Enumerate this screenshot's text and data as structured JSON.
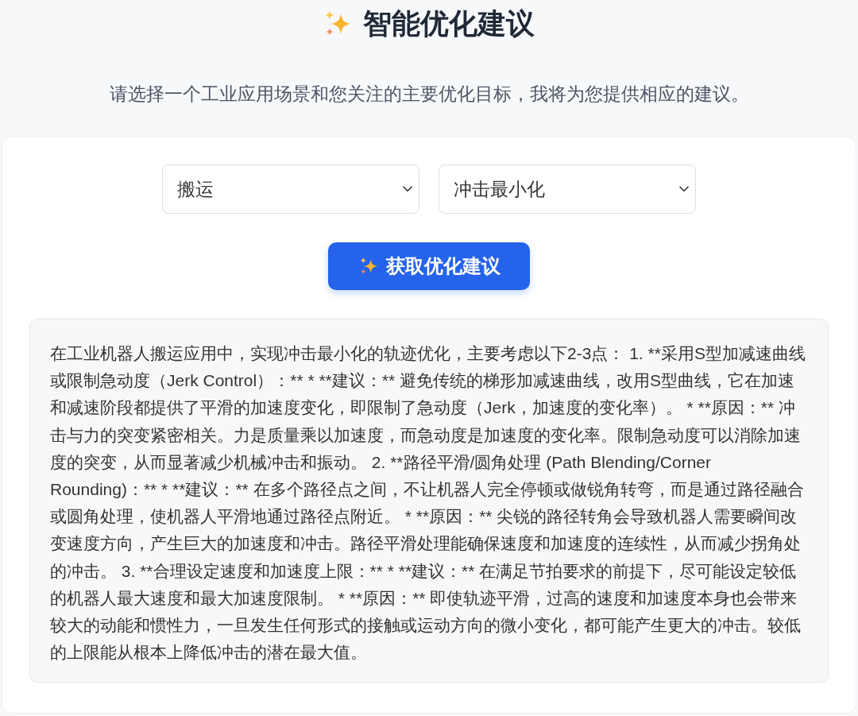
{
  "header": {
    "title": "智能优化建议",
    "subtitle": "请选择一个工业应用场景和您关注的主要优化目标，我将为您提供相应的建议。"
  },
  "form": {
    "selects": [
      {
        "value": "搬运"
      },
      {
        "value": "冲击最小化"
      }
    ],
    "button": {
      "label": "获取优化建议"
    }
  },
  "result": {
    "text": "在工业机器人搬运应用中，实现冲击最小化的轨迹优化，主要考虑以下2-3点： 1. **采用S型加减速曲线或限制急动度（Jerk Control）：** * **建议：** 避免传统的梯形加减速曲线，改用S型曲线，它在加速和减速阶段都提供了平滑的加速度变化，即限制了急动度（Jerk，加速度的变化率）。 * **原因：** 冲击与力的突变紧密相关。力是质量乘以加速度，而急动度是加速度的变化率。限制急动度可以消除加速度的突变，从而显著减少机械冲击和振动。 2. **路径平滑/圆角处理 (Path Blending/Corner Rounding)：** * **建议：** 在多个路径点之间，不让机器人完全停顿或做锐角转弯，而是通过路径融合或圆角处理，使机器人平滑地通过路径点附近。 * **原因：** 尖锐的路径转角会导致机器人需要瞬间改变速度方向，产生巨大的加速度和冲击。路径平滑处理能确保速度和加速度的连续性，从而减少拐角处的冲击。 3. **合理设定速度和加速度上限：** * **建议：** 在满足节拍要求的前提下，尽可能设定较低的机器人最大速度和最大加速度限制。 * **原因：** 即使轨迹平滑，过高的速度和加速度本身也会带来较大的动能和惯性力，一旦发生任何形式的接触或运动方向的微小变化，都可能产生更大的冲击。较低的上限能从根本上降低冲击的潜在最大值。"
  }
}
